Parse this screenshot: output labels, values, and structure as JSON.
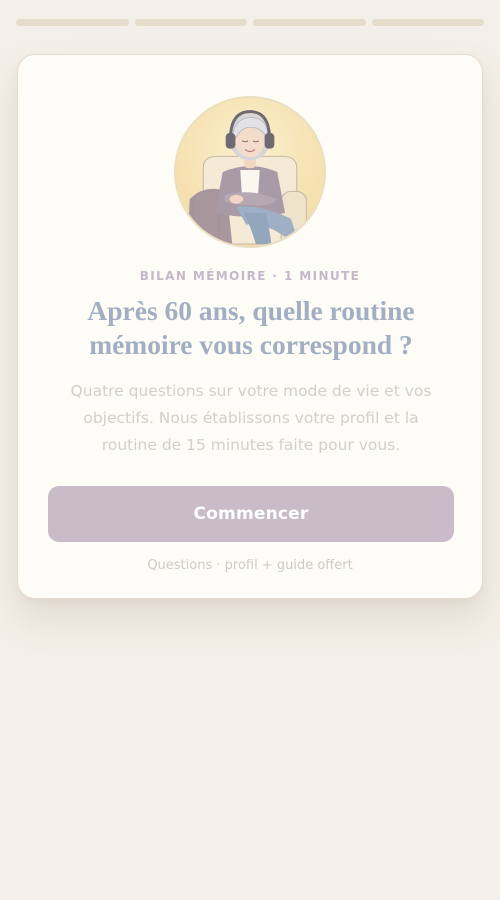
{
  "progress": {
    "total_steps": 4,
    "current_step": 0
  },
  "card": {
    "illustration": "senior-woman-armchair-headphones-illustration",
    "eyebrow": "BILAN MÉMOIRE · 1 MINUTE",
    "headline_line1": "Après 60 ans, quelle routine",
    "headline_line2": "mémoire vous correspond ?",
    "description_line1": "Quatre questions sur votre mode de vie et vos",
    "description_line2": "objectifs. Nous établissons votre profil et la",
    "description_line3": "routine de 15 minutes faite pour vous.",
    "cta_label": "Commencer",
    "footnote": "Questions · profil + guide offert"
  },
  "colors": {
    "background": "#f4efe8",
    "card_background": "#fdfcf6",
    "progress_segment": "#e6dccb",
    "eyebrow": "#c4b9c9",
    "headline": "#a2afc3",
    "description": "#d4cec8",
    "cta_background": "#c9bcc8",
    "cta_text": "#ffffff",
    "avatar_background": "#f6e4b4"
  }
}
